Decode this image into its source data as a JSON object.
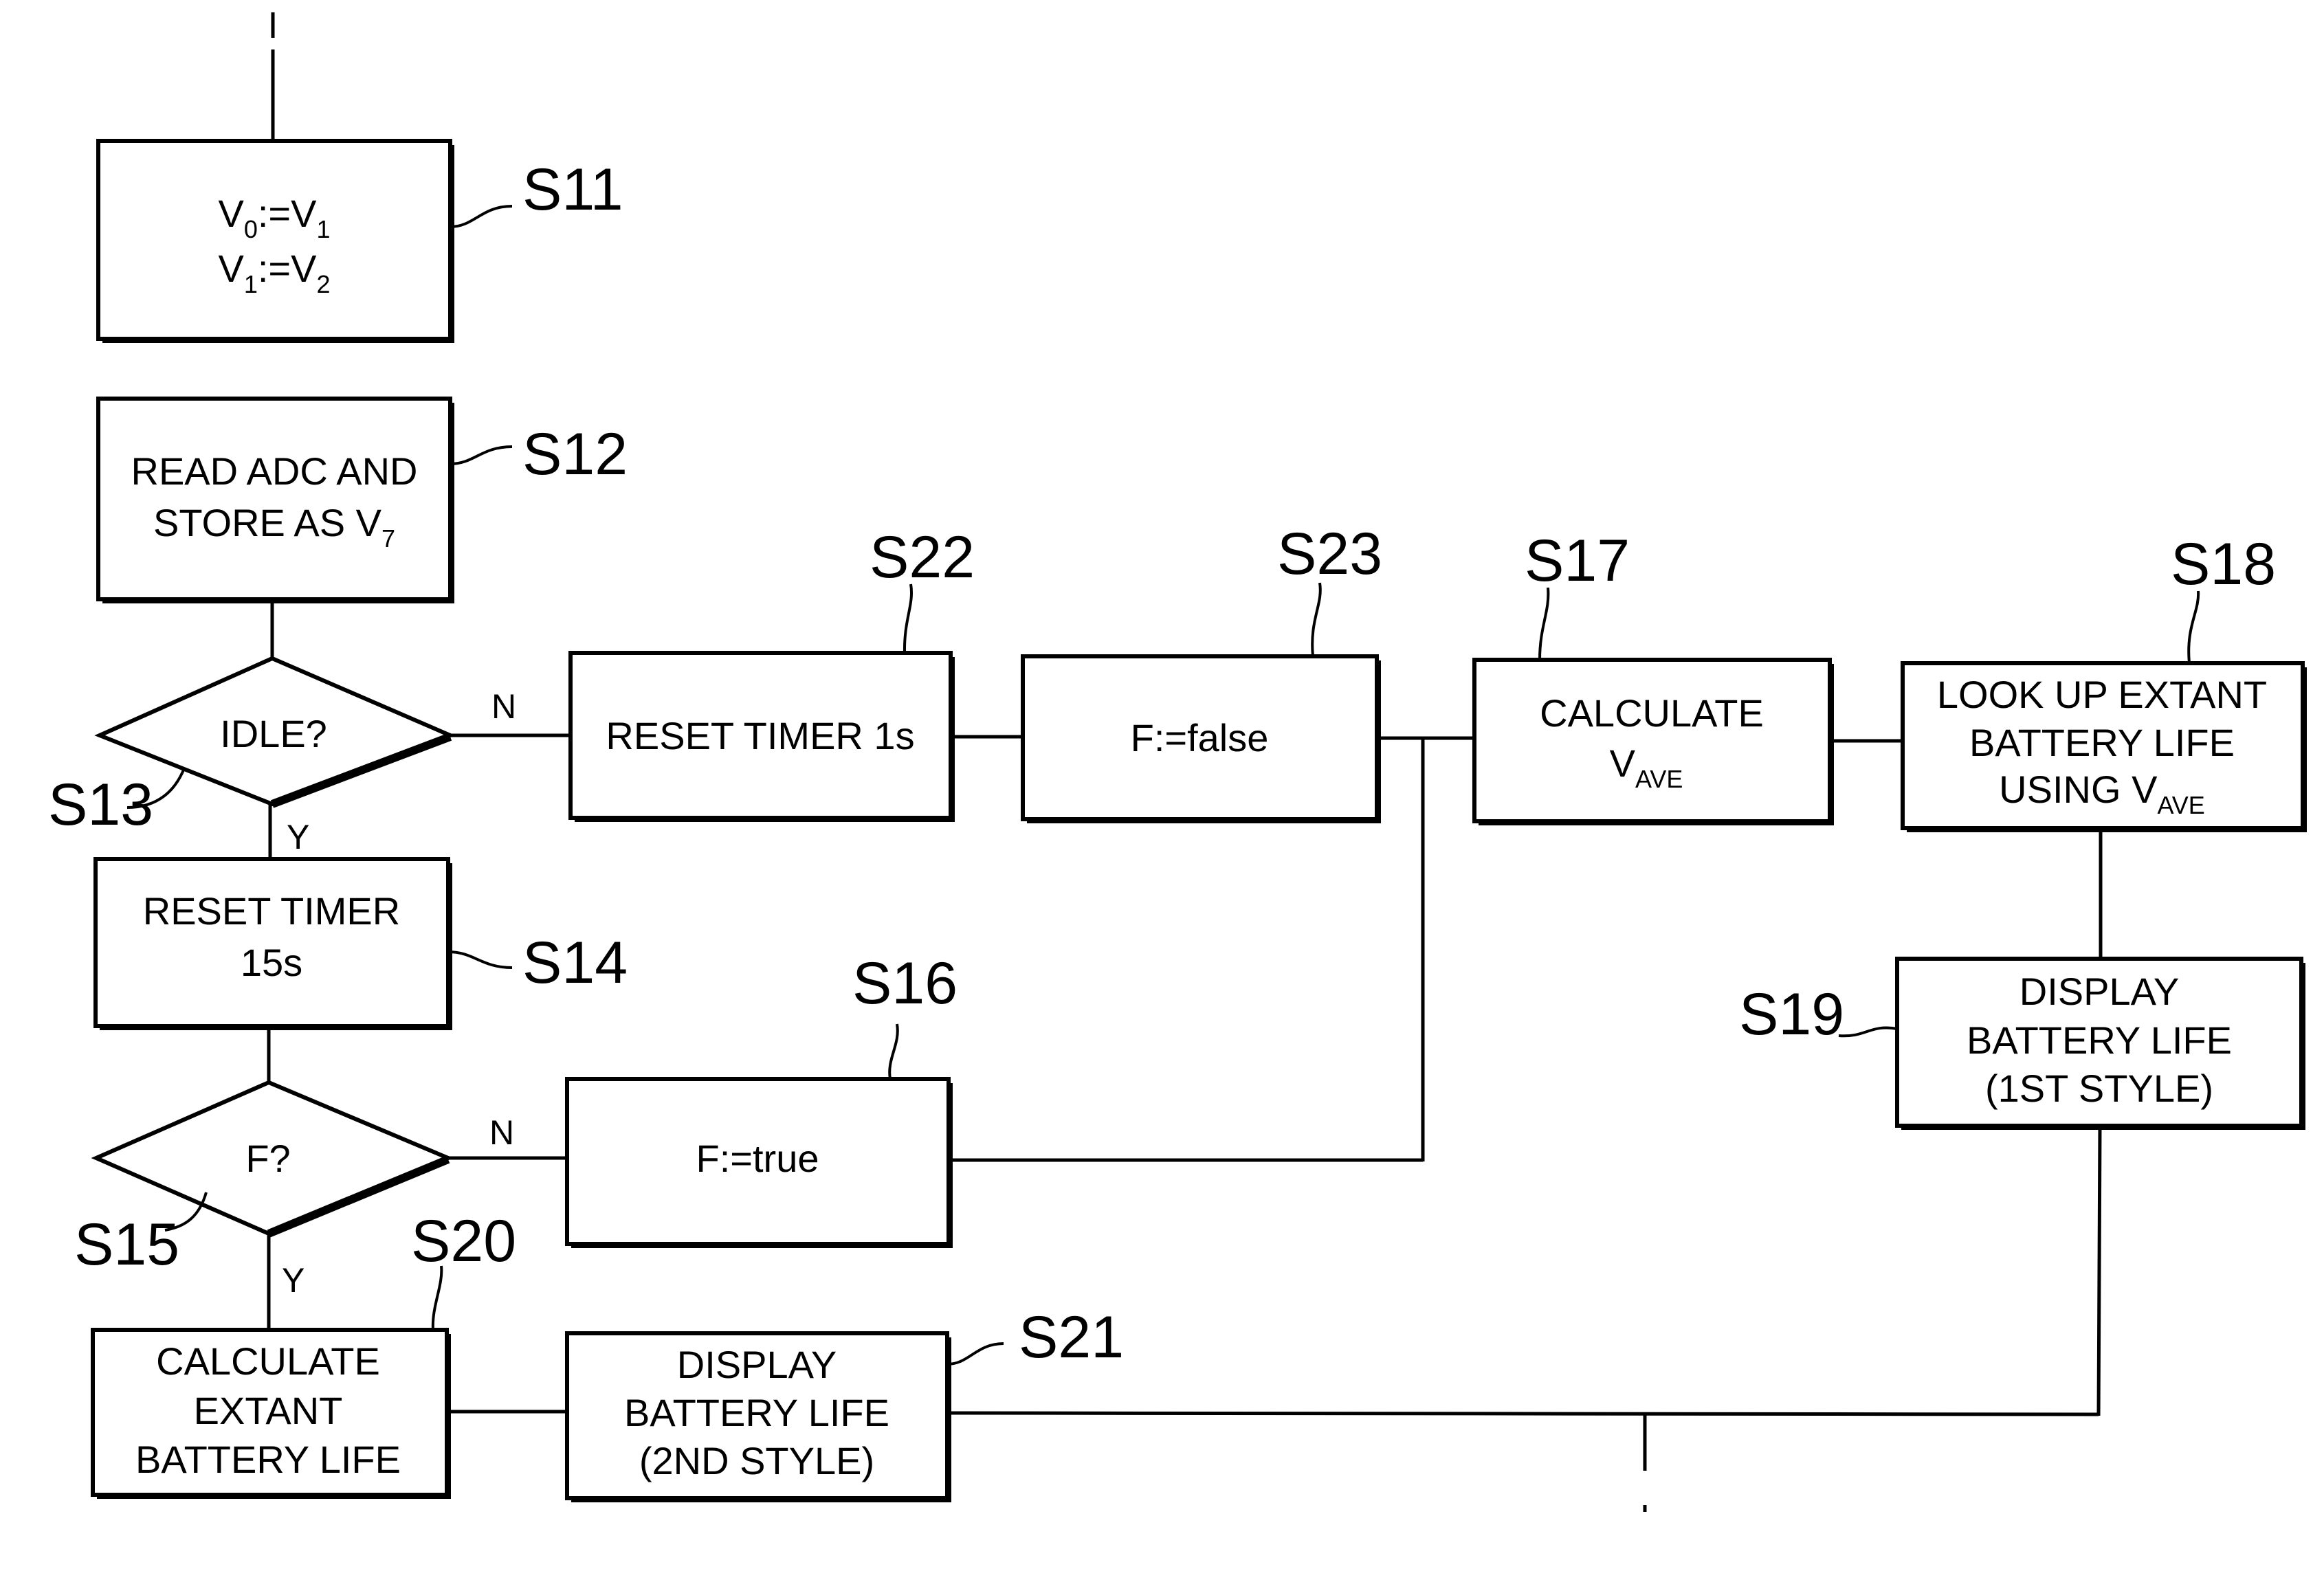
{
  "figure": {
    "type": "flowchart",
    "steps": {
      "s11": {
        "ref": "S11",
        "lines": [
          "V0:=V1",
          "V1:=V2"
        ]
      },
      "s12": {
        "ref": "S12",
        "line1": "READ ADC AND",
        "line2_main": "STORE AS V",
        "line2_sub": "7"
      },
      "s13": {
        "ref": "S13",
        "label": "IDLE?",
        "no": "N",
        "yes": "Y"
      },
      "s14": {
        "ref": "S14",
        "lines": [
          "RESET TIMER",
          "15s"
        ]
      },
      "s15": {
        "ref": "S15",
        "label": "F?",
        "no": "N",
        "yes": "Y"
      },
      "s16": {
        "ref": "S16",
        "label": "F:=true"
      },
      "s17": {
        "ref": "S17",
        "line1": "CALCULATE",
        "line2_main": "V",
        "line2_sub": "AVE"
      },
      "s18": {
        "ref": "S18",
        "line1": "LOOK UP EXTANT",
        "line2": "BATTERY LIFE",
        "line3_main": "USING V",
        "line3_sub": "AVE"
      },
      "s19": {
        "ref": "S19",
        "lines": [
          "DISPLAY",
          "BATTERY LIFE",
          "(1ST STYLE)"
        ]
      },
      "s20": {
        "ref": "S20",
        "lines": [
          "CALCULATE",
          "EXTANT",
          "BATTERY LIFE"
        ]
      },
      "s21": {
        "ref": "S21",
        "lines": [
          "DISPLAY",
          "BATTERY LIFE",
          "(2ND STYLE)"
        ]
      },
      "s22": {
        "ref": "S22",
        "label": "RESET TIMER 1s"
      },
      "s23": {
        "ref": "S23",
        "label": "F:=false"
      }
    },
    "s11_parts": {
      "l1a": "V",
      "l1a_sub": "0",
      "l1b": ":=V",
      "l1b_sub": "1",
      "l2a": "V",
      "l2a_sub": "1",
      "l2b": ":=V",
      "l2b_sub": "2"
    }
  }
}
